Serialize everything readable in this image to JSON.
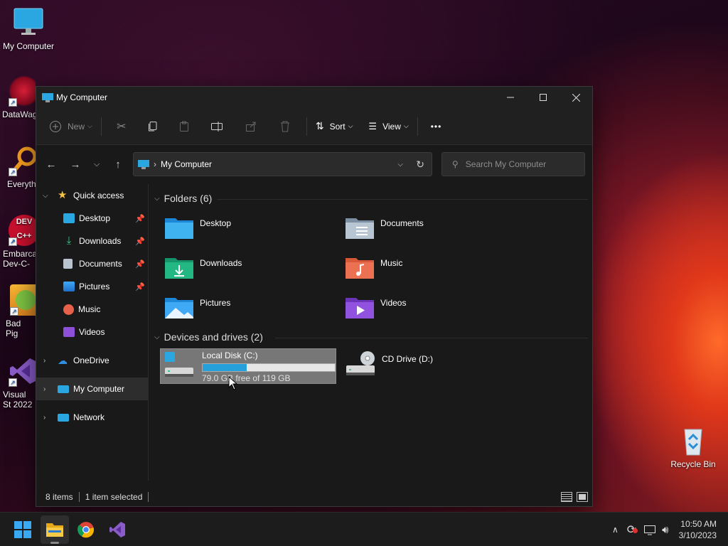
{
  "desktop": {
    "icons": [
      {
        "label": "My Computer"
      },
      {
        "label": "DataWag"
      },
      {
        "label": "Everyth"
      },
      {
        "label": "Embarca Dev-C-"
      },
      {
        "label": "Bad Pig"
      },
      {
        "label": "Visual St 2022"
      },
      {
        "label": "Recycle Bin"
      }
    ]
  },
  "window": {
    "title": "My Computer",
    "commands": {
      "new": "New",
      "sort": "Sort",
      "view": "View",
      "more": "•••"
    },
    "address": {
      "path": "My Computer"
    },
    "search": {
      "placeholder": "Search My Computer"
    },
    "sidebar": {
      "quick_access": "Quick access",
      "items": [
        {
          "label": "Desktop",
          "pin": "📌"
        },
        {
          "label": "Downloads",
          "pin": "📌"
        },
        {
          "label": "Documents",
          "pin": "📌"
        },
        {
          "label": "Pictures",
          "pin": "📌"
        },
        {
          "label": "Music"
        },
        {
          "label": "Videos"
        }
      ],
      "onedrive": "OneDrive",
      "my_computer": "My Computer",
      "network": "Network"
    },
    "folders_header": "Folders (6)",
    "folders": [
      {
        "label": "Desktop"
      },
      {
        "label": "Documents"
      },
      {
        "label": "Downloads"
      },
      {
        "label": "Music"
      },
      {
        "label": "Pictures"
      },
      {
        "label": "Videos"
      }
    ],
    "drives_header": "Devices and drives (2)",
    "drives": [
      {
        "label": "Local Disk (C:)",
        "free": "79.0 GB free of 119 GB",
        "used_fraction": 0.336
      },
      {
        "label": "CD Drive (D:)"
      }
    ],
    "status": {
      "items": "8 items",
      "selected": "1 item selected"
    }
  },
  "taskbar": {
    "time": "10:50 AM",
    "date": "3/10/2023"
  },
  "colors": {
    "accent": "#26a0da",
    "window_bg": "#191919",
    "taskbar_bg": "#1c1c1c"
  }
}
